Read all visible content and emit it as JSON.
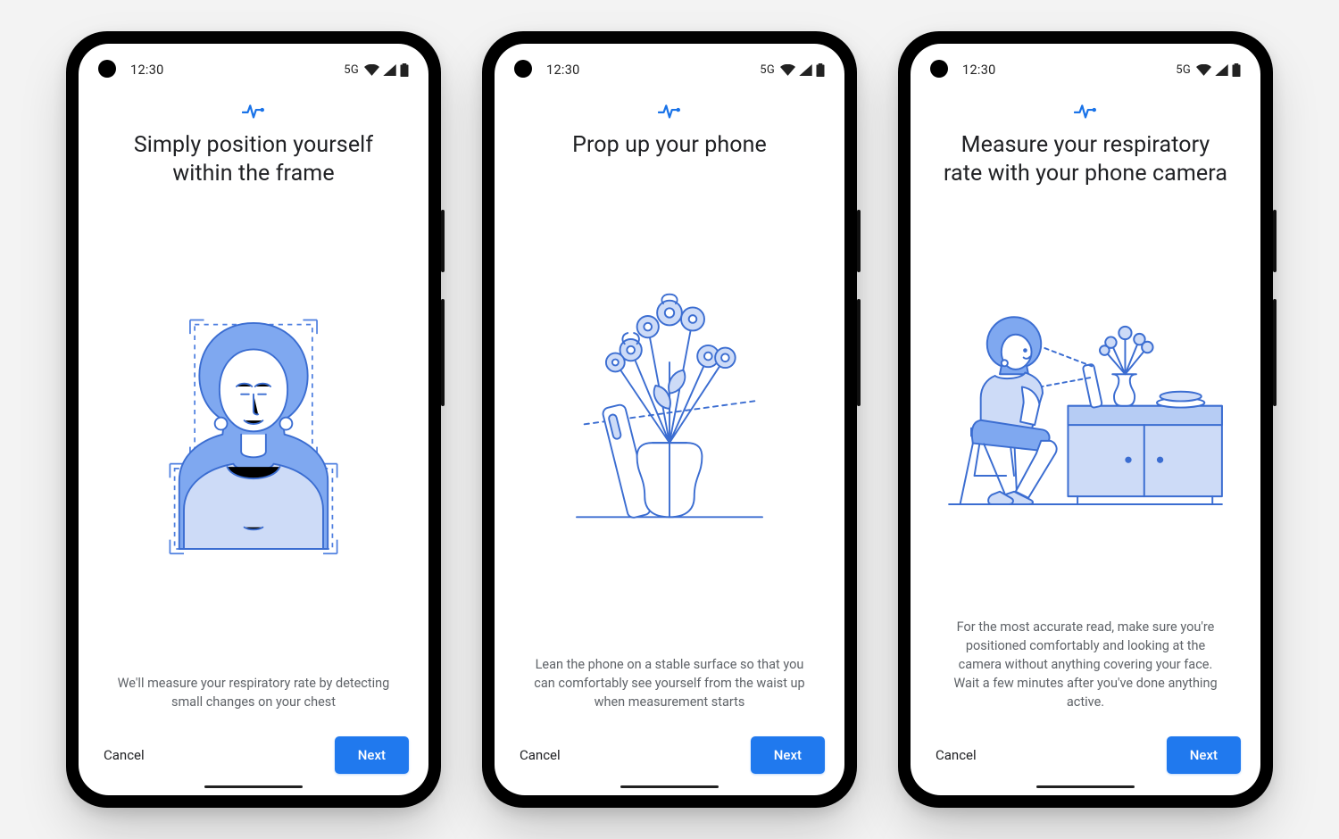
{
  "status": {
    "time": "12:30",
    "network_label": "5G"
  },
  "colors": {
    "primary": "#1a73e8",
    "button_bg": "#2079ee"
  },
  "screens": [
    {
      "headline": "Simply position yourself within the frame",
      "description": "We'll measure your respiratory rate by detecting small changes on your chest",
      "cancel_label": "Cancel",
      "next_label": "Next",
      "illustration": "person-in-frame"
    },
    {
      "headline": "Prop up your phone",
      "description": "Lean the phone on a stable surface so that you can comfortably see yourself from the waist up when measurement starts",
      "cancel_label": "Cancel",
      "next_label": "Next",
      "illustration": "phone-vase"
    },
    {
      "headline": "Measure your respiratory rate with your phone camera",
      "description": "For the most accurate read, make sure you're positioned comfortably and looking at the camera without anything covering your face. Wait a few minutes after you've done anything active.",
      "cancel_label": "Cancel",
      "next_label": "Next",
      "illustration": "person-seated-phone"
    }
  ]
}
